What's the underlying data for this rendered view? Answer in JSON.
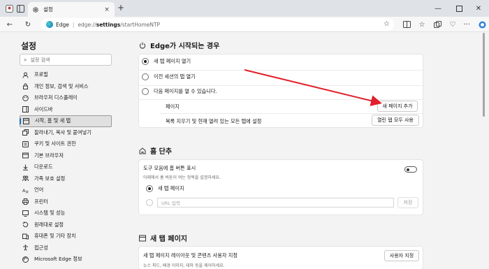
{
  "browser": {
    "tab_title": "설정",
    "new_tab": "+",
    "address_brand": "Edge",
    "url_prefix": "edge://",
    "url_bold": "settings",
    "url_suffix": "/startHomeNTP"
  },
  "sidebar": {
    "title": "설정",
    "search_placeholder": "설정 검색",
    "items": [
      {
        "label": "프로필",
        "icon": "profile-icon"
      },
      {
        "label": "개인 정보, 검색 및 서비스",
        "icon": "lock-icon"
      },
      {
        "label": "브라우저 디스플레이",
        "icon": "appearance-icon"
      },
      {
        "label": "사이드바",
        "icon": "sidebar-icon"
      },
      {
        "label": "시작, 홈 및 새 탭",
        "icon": "start-icon"
      },
      {
        "label": "잘라내기, 복사 및 붙여넣기",
        "icon": "share-icon"
      },
      {
        "label": "쿠키 및 사이트 권한",
        "icon": "cookie-icon"
      },
      {
        "label": "기본 브라우저",
        "icon": "browser-icon"
      },
      {
        "label": "다운로드",
        "icon": "download-icon"
      },
      {
        "label": "가족 보호 설정",
        "icon": "family-icon"
      },
      {
        "label": "언어",
        "icon": "language-icon"
      },
      {
        "label": "프린터",
        "icon": "printer-icon"
      },
      {
        "label": "시스템 및 성능",
        "icon": "system-icon"
      },
      {
        "label": "원래대로 설정",
        "icon": "reset-icon"
      },
      {
        "label": "휴대폰 및 기타 장치",
        "icon": "phone-icon"
      },
      {
        "label": "접근성",
        "icon": "accessibility-icon"
      },
      {
        "label": "Microsoft Edge 정보",
        "icon": "edge-icon"
      }
    ]
  },
  "startup": {
    "heading": "Edge가 시작되는 경우",
    "options": [
      "새 탭 페이지 열기",
      "이전 세션의 탭 열기",
      "다음 페이지를 열 수 있습니다."
    ],
    "pages_label": "페이지",
    "add_page_button": "새 페이지 추가",
    "use_all_tabs_label": "목록 지우기 및 현재 열려 있는 모든 탭에 설정",
    "use_all_tabs_button": "열린 탭 모두 사용"
  },
  "home": {
    "heading": "홈 단추",
    "toggle_label": "도구 모음에 홈 버튼 표시",
    "toggle_desc": "아래에서 홈 버튼이 여는 항목을 설정하세요.",
    "option_newtab": "새 탭 페이지",
    "url_placeholder": "URL 입력",
    "save_button": "저장"
  },
  "newtab": {
    "heading": "새 탭 페이지",
    "customize_label": "새 탭 페이지 레이아웃 및 콘텐츠 사용자 지정",
    "customize_desc": "뉴스 피드, 배경 이미지, 테마 등을 제어하세요.",
    "customize_button": "사용자 지정"
  },
  "colors": {
    "accent": "#0f6cbd",
    "arrow": "#e0202a"
  }
}
